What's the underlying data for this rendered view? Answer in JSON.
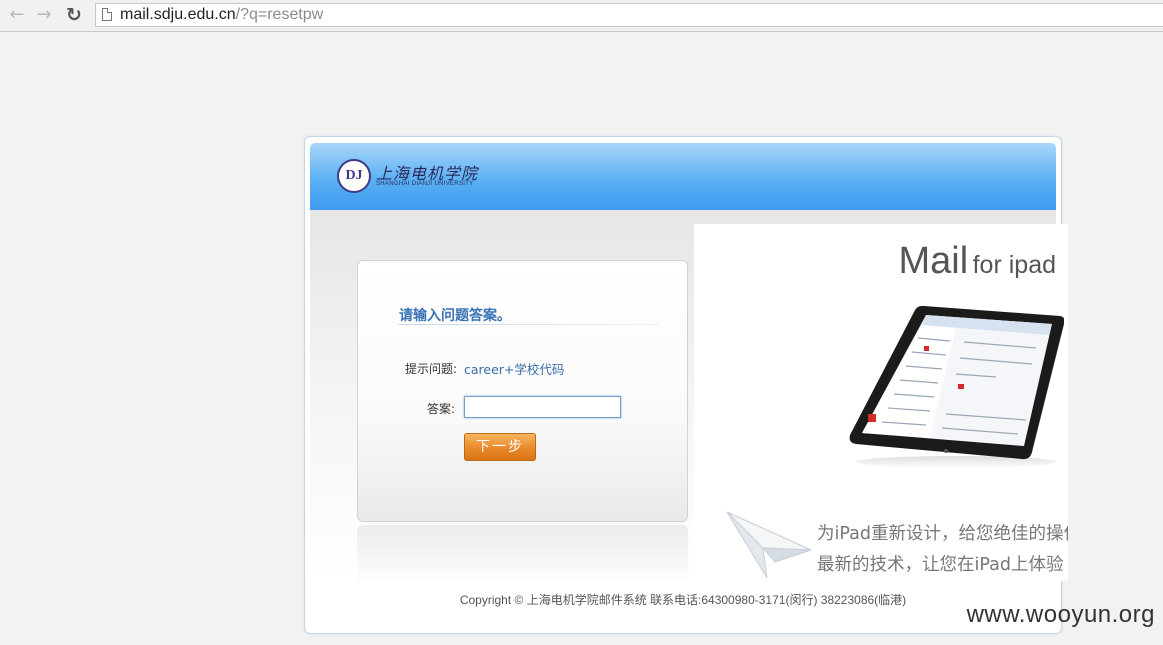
{
  "browser": {
    "url_host": "mail.sdju.edu.cn",
    "url_path": "/?q=resetpw"
  },
  "header": {
    "logo_seal": "DJ",
    "logo_cn": "上海电机学院",
    "logo_en": "SHANGHAI DIANJI UNIVERSITY"
  },
  "form": {
    "title": "请输入问题答案。",
    "hint_label": "提示问题:",
    "hint_value": "career+学校代码",
    "answer_label": "答案:",
    "answer_value": "",
    "next_button": "下一步"
  },
  "promo": {
    "title_big": "Mail",
    "title_small": "for ipad",
    "line1": "为iPad重新设计，给您绝佳的操作",
    "line2": "最新的技术，让您在iPad上体验"
  },
  "footer": {
    "copyright": "Copyright © 上海电机学院邮件系统 联系电话:64300980-3171(闵行) 38223086(临港)"
  },
  "watermark": "www.wooyun.org"
}
